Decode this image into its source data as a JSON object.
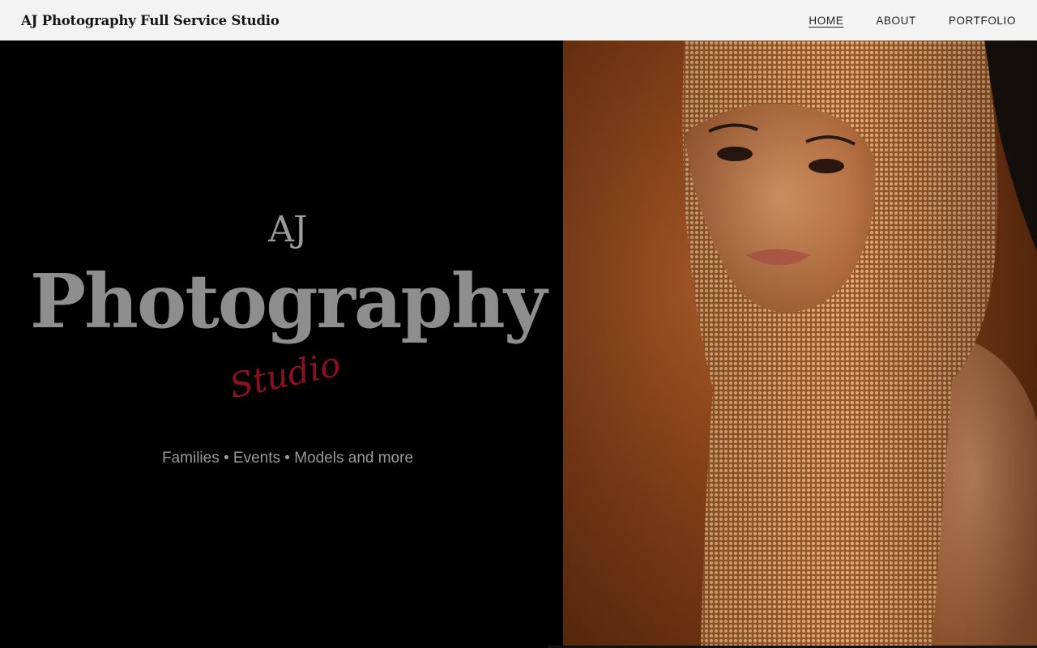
{
  "header": {
    "site_title": "AJ Photography Full Service Studio",
    "nav": [
      {
        "label": "HOME",
        "active": true
      },
      {
        "label": "ABOUT",
        "active": false
      },
      {
        "label": "PORTFOLIO",
        "active": false
      }
    ]
  },
  "hero": {
    "logo_aj": "AJ",
    "logo_photography": "Photography",
    "logo_studio": "Studio",
    "tagline": "Families • Events • Models and more"
  },
  "image": {
    "icon": "portrait-photo",
    "colors": {
      "background": "#8f4418",
      "mesh": "#d9a06b",
      "skin": "#c98456",
      "hair": "#1a1210"
    }
  }
}
